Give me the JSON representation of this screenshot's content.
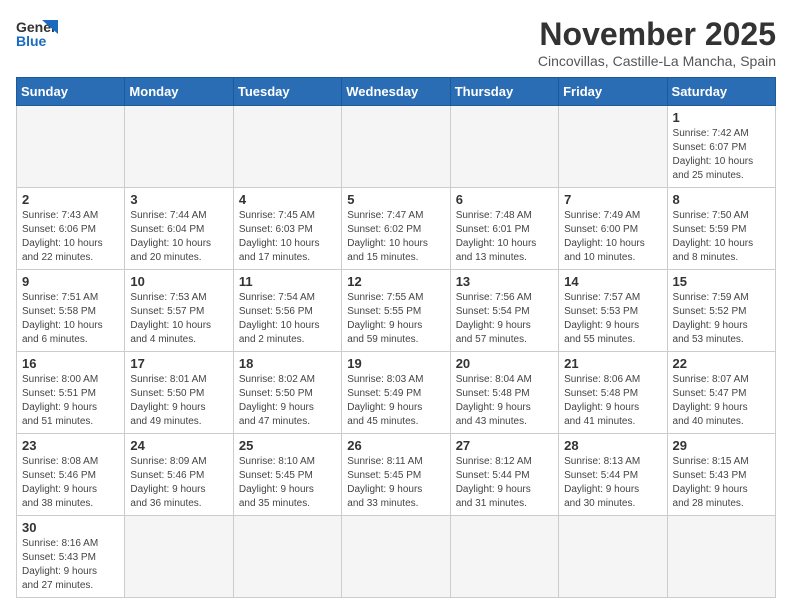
{
  "header": {
    "logo_general": "General",
    "logo_blue": "Blue",
    "month": "November 2025",
    "location": "Cincovillas, Castille-La Mancha, Spain"
  },
  "weekdays": [
    "Sunday",
    "Monday",
    "Tuesday",
    "Wednesday",
    "Thursday",
    "Friday",
    "Saturday"
  ],
  "days": [
    {
      "num": "",
      "info": ""
    },
    {
      "num": "",
      "info": ""
    },
    {
      "num": "",
      "info": ""
    },
    {
      "num": "",
      "info": ""
    },
    {
      "num": "",
      "info": ""
    },
    {
      "num": "",
      "info": ""
    },
    {
      "num": "1",
      "info": "Sunrise: 7:42 AM\nSunset: 6:07 PM\nDaylight: 10 hours\nand 25 minutes."
    },
    {
      "num": "2",
      "info": "Sunrise: 7:43 AM\nSunset: 6:06 PM\nDaylight: 10 hours\nand 22 minutes."
    },
    {
      "num": "3",
      "info": "Sunrise: 7:44 AM\nSunset: 6:04 PM\nDaylight: 10 hours\nand 20 minutes."
    },
    {
      "num": "4",
      "info": "Sunrise: 7:45 AM\nSunset: 6:03 PM\nDaylight: 10 hours\nand 17 minutes."
    },
    {
      "num": "5",
      "info": "Sunrise: 7:47 AM\nSunset: 6:02 PM\nDaylight: 10 hours\nand 15 minutes."
    },
    {
      "num": "6",
      "info": "Sunrise: 7:48 AM\nSunset: 6:01 PM\nDaylight: 10 hours\nand 13 minutes."
    },
    {
      "num": "7",
      "info": "Sunrise: 7:49 AM\nSunset: 6:00 PM\nDaylight: 10 hours\nand 10 minutes."
    },
    {
      "num": "8",
      "info": "Sunrise: 7:50 AM\nSunset: 5:59 PM\nDaylight: 10 hours\nand 8 minutes."
    },
    {
      "num": "9",
      "info": "Sunrise: 7:51 AM\nSunset: 5:58 PM\nDaylight: 10 hours\nand 6 minutes."
    },
    {
      "num": "10",
      "info": "Sunrise: 7:53 AM\nSunset: 5:57 PM\nDaylight: 10 hours\nand 4 minutes."
    },
    {
      "num": "11",
      "info": "Sunrise: 7:54 AM\nSunset: 5:56 PM\nDaylight: 10 hours\nand 2 minutes."
    },
    {
      "num": "12",
      "info": "Sunrise: 7:55 AM\nSunset: 5:55 PM\nDaylight: 9 hours\nand 59 minutes."
    },
    {
      "num": "13",
      "info": "Sunrise: 7:56 AM\nSunset: 5:54 PM\nDaylight: 9 hours\nand 57 minutes."
    },
    {
      "num": "14",
      "info": "Sunrise: 7:57 AM\nSunset: 5:53 PM\nDaylight: 9 hours\nand 55 minutes."
    },
    {
      "num": "15",
      "info": "Sunrise: 7:59 AM\nSunset: 5:52 PM\nDaylight: 9 hours\nand 53 minutes."
    },
    {
      "num": "16",
      "info": "Sunrise: 8:00 AM\nSunset: 5:51 PM\nDaylight: 9 hours\nand 51 minutes."
    },
    {
      "num": "17",
      "info": "Sunrise: 8:01 AM\nSunset: 5:50 PM\nDaylight: 9 hours\nand 49 minutes."
    },
    {
      "num": "18",
      "info": "Sunrise: 8:02 AM\nSunset: 5:50 PM\nDaylight: 9 hours\nand 47 minutes."
    },
    {
      "num": "19",
      "info": "Sunrise: 8:03 AM\nSunset: 5:49 PM\nDaylight: 9 hours\nand 45 minutes."
    },
    {
      "num": "20",
      "info": "Sunrise: 8:04 AM\nSunset: 5:48 PM\nDaylight: 9 hours\nand 43 minutes."
    },
    {
      "num": "21",
      "info": "Sunrise: 8:06 AM\nSunset: 5:48 PM\nDaylight: 9 hours\nand 41 minutes."
    },
    {
      "num": "22",
      "info": "Sunrise: 8:07 AM\nSunset: 5:47 PM\nDaylight: 9 hours\nand 40 minutes."
    },
    {
      "num": "23",
      "info": "Sunrise: 8:08 AM\nSunset: 5:46 PM\nDaylight: 9 hours\nand 38 minutes."
    },
    {
      "num": "24",
      "info": "Sunrise: 8:09 AM\nSunset: 5:46 PM\nDaylight: 9 hours\nand 36 minutes."
    },
    {
      "num": "25",
      "info": "Sunrise: 8:10 AM\nSunset: 5:45 PM\nDaylight: 9 hours\nand 35 minutes."
    },
    {
      "num": "26",
      "info": "Sunrise: 8:11 AM\nSunset: 5:45 PM\nDaylight: 9 hours\nand 33 minutes."
    },
    {
      "num": "27",
      "info": "Sunrise: 8:12 AM\nSunset: 5:44 PM\nDaylight: 9 hours\nand 31 minutes."
    },
    {
      "num": "28",
      "info": "Sunrise: 8:13 AM\nSunset: 5:44 PM\nDaylight: 9 hours\nand 30 minutes."
    },
    {
      "num": "29",
      "info": "Sunrise: 8:15 AM\nSunset: 5:43 PM\nDaylight: 9 hours\nand 28 minutes."
    },
    {
      "num": "30",
      "info": "Sunrise: 8:16 AM\nSunset: 5:43 PM\nDaylight: 9 hours\nand 27 minutes."
    },
    {
      "num": "",
      "info": ""
    },
    {
      "num": "",
      "info": ""
    },
    {
      "num": "",
      "info": ""
    },
    {
      "num": "",
      "info": ""
    },
    {
      "num": "",
      "info": ""
    },
    {
      "num": "",
      "info": ""
    }
  ]
}
